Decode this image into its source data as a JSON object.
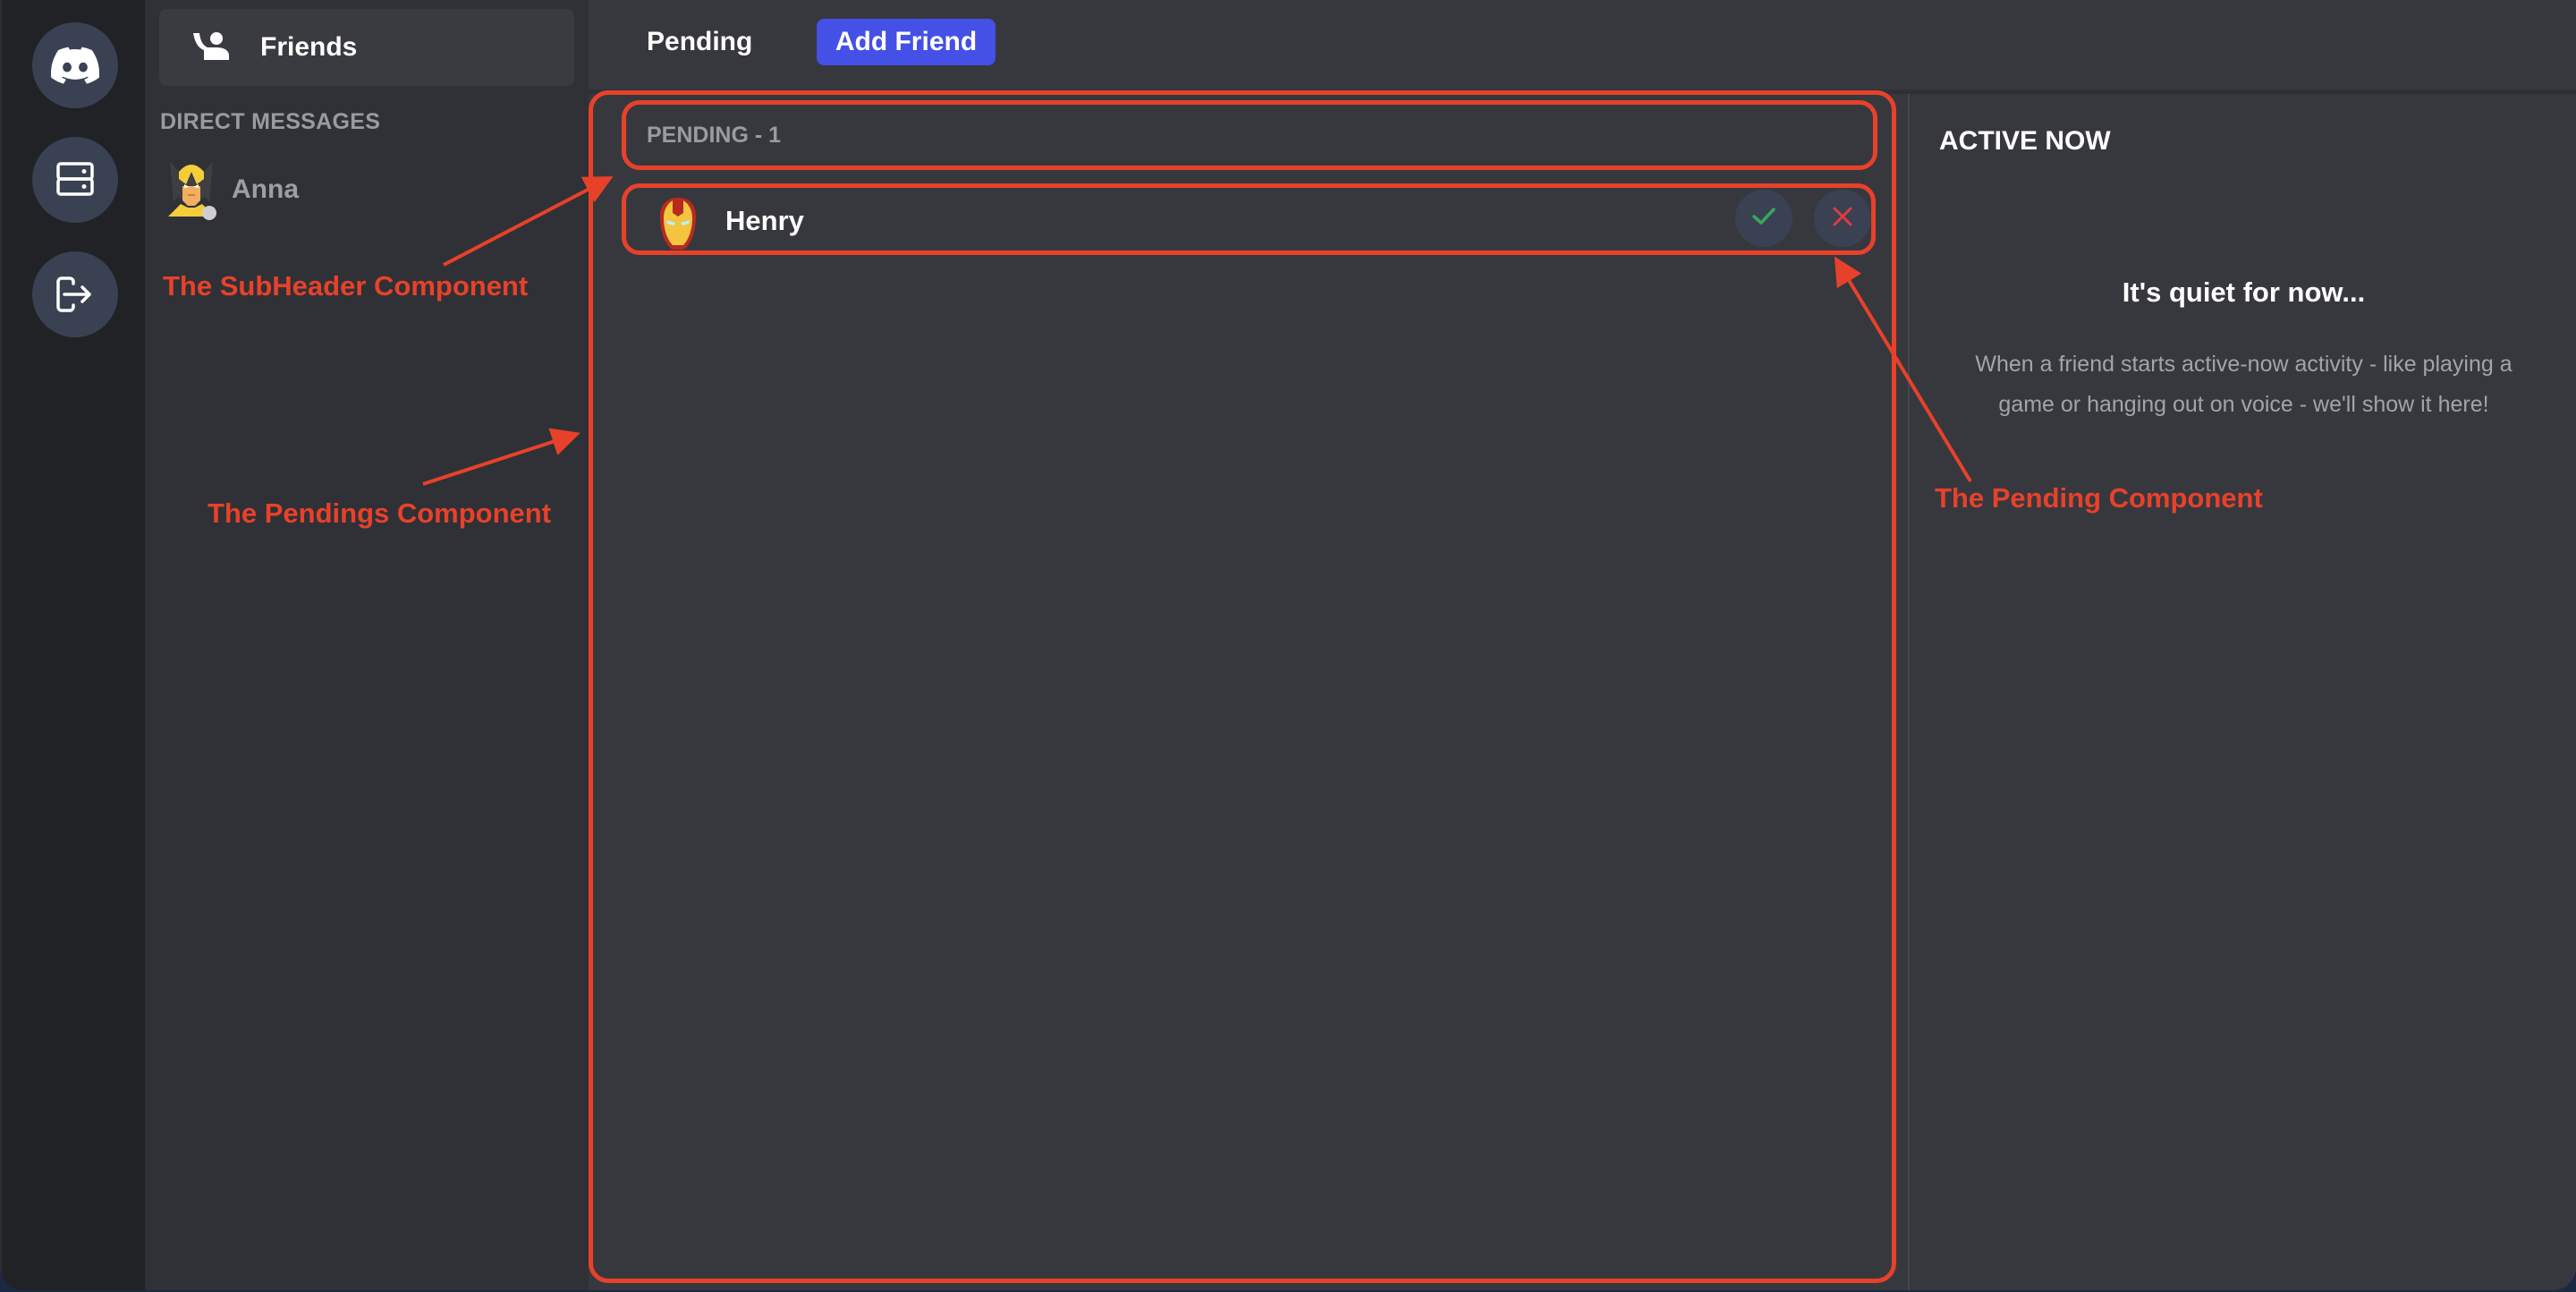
{
  "rail": {
    "buttons": [
      {
        "icon": "discord-logo-icon",
        "label": "Home"
      },
      {
        "icon": "server-icon",
        "label": "Servers"
      },
      {
        "icon": "logout-icon",
        "label": "Logout"
      }
    ]
  },
  "sidebar": {
    "friends_label": "Friends",
    "friends_icon": "friends-wave-icon",
    "dm_title": "DIRECT MESSAGES",
    "dms": [
      {
        "name": "Anna",
        "avatar": "wolverine-avatar",
        "status": "offline"
      }
    ]
  },
  "header": {
    "tab_pending": "Pending",
    "add_friend": "Add Friend"
  },
  "pendings": {
    "subheader": "PENDING - 1",
    "items": [
      {
        "name": "Henry",
        "avatar": "iron-man-avatar",
        "accept_icon": "check-icon",
        "decline_icon": "close-icon"
      }
    ]
  },
  "active_now": {
    "title": "ACTIVE NOW",
    "empty_title": "It's quiet for now...",
    "empty_desc": "When a friend starts active-now activity - like playing a game or hanging out on voice - we'll show it here!"
  },
  "annotations": {
    "subheader": "The SubHeader Component",
    "pendings": "The Pendings Component",
    "pending": "The Pending Component"
  },
  "colors": {
    "accent": "#4450e6",
    "annotation": "#e8412a",
    "accept": "#3ba55c",
    "decline": "#e03c3c"
  }
}
